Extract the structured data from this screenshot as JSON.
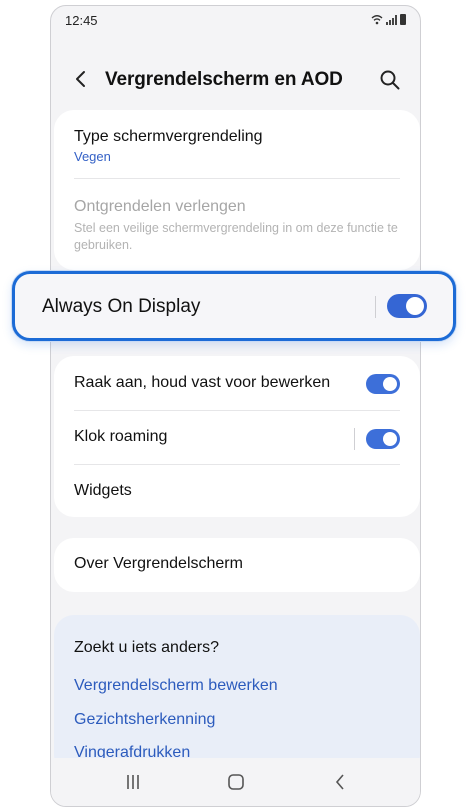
{
  "status_bar": {
    "time": "12:45"
  },
  "header": {
    "title": "Vergrendelscherm en AOD"
  },
  "lock_card": {
    "type_title": "Type schermvergrendeling",
    "type_value": "Vegen",
    "extend_title": "Ontgrendelen verlengen",
    "extend_desc": "Stel een veilige schermvergrendeling in om deze functie te gebruiken."
  },
  "aod": {
    "label": "Always On Display",
    "enabled": true
  },
  "options_card": {
    "touch_hold_label": "Raak aan, houd vast voor bewerken",
    "touch_hold_enabled": true,
    "roaming_label": "Klok roaming",
    "roaming_enabled": true,
    "widgets_label": "Widgets"
  },
  "about": {
    "label": "Over Vergrendelscherm"
  },
  "suggestions": {
    "question": "Zoekt u iets anders?",
    "links": [
      "Vergrendelscherm bewerken",
      "Gezichtsherkenning",
      "Vingerafdrukken"
    ]
  },
  "colors": {
    "accent": "#1c6bd6",
    "toggle_on": "#3d6fd9",
    "link": "#2c5bbd"
  }
}
